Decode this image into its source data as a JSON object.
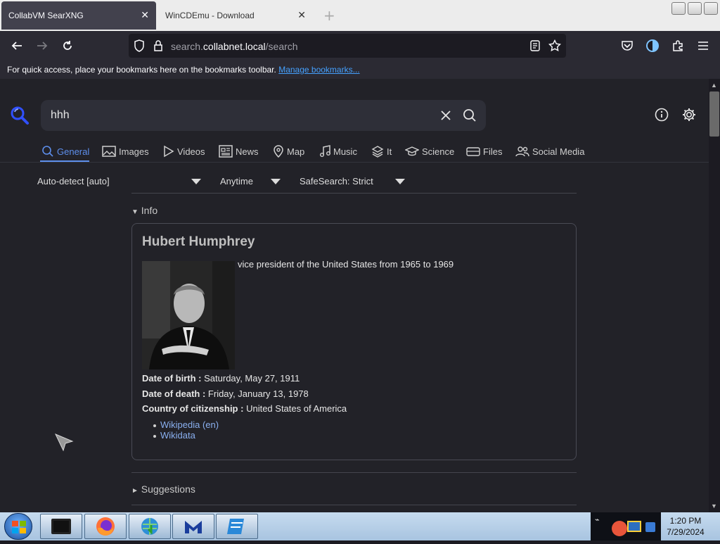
{
  "browser": {
    "tabs": [
      {
        "label": "CollabVM SearXNG",
        "active": true
      },
      {
        "label": "WinCDEmu - Download",
        "active": false
      }
    ],
    "url": {
      "prefix": "search.",
      "domain": "collabnet.local",
      "path": "/search"
    },
    "bookmarks_text": "For quick access, place your bookmarks here on the bookmarks toolbar.",
    "bookmarks_link": "Manage bookmarks..."
  },
  "search": {
    "query": "hhh",
    "categories": [
      {
        "label": "General",
        "icon": "search-icon",
        "active": true
      },
      {
        "label": "Images",
        "icon": "image-icon"
      },
      {
        "label": "Videos",
        "icon": "play-icon"
      },
      {
        "label": "News",
        "icon": "newspaper-icon"
      },
      {
        "label": "Map",
        "icon": "map-pin-icon"
      },
      {
        "label": "Music",
        "icon": "music-icon"
      },
      {
        "label": "It",
        "icon": "layers-icon"
      },
      {
        "label": "Science",
        "icon": "graduation-cap-icon"
      },
      {
        "label": "Files",
        "icon": "drive-icon"
      },
      {
        "label": "Social Media",
        "icon": "people-icon"
      }
    ],
    "filters": {
      "language": "Auto-detect [auto]",
      "time": "Anytime",
      "safesearch": "SafeSearch: Strict"
    }
  },
  "infobox": {
    "section_label": "Info",
    "title": "Hubert Humphrey",
    "description": "vice president of the United States from 1965 to 1969",
    "attributes": [
      {
        "key": "Date of birth :",
        "value": "Saturday, May 27, 1911"
      },
      {
        "key": "Date of death :",
        "value": "Friday, January 13, 1978"
      },
      {
        "key": "Country of citizenship :",
        "value": "United States of America"
      }
    ],
    "links": [
      "Wikipedia (en)",
      "Wikidata"
    ]
  },
  "suggestions_label": "Suggestions",
  "taskbar": {
    "time": "1:20 PM",
    "date": "7/29/2024"
  },
  "colors": {
    "accent": "#5d8eeb",
    "link": "#8ab0f0",
    "background": "#222228"
  }
}
